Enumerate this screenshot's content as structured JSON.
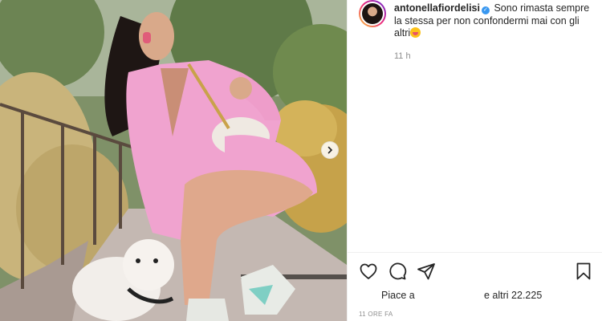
{
  "post": {
    "username": "antonellafiordelisi",
    "caption": "Sono rimasta sempre la stessa per non confondermi mai con gli altri",
    "time_ago": "11 h",
    "likes_prefix": "Piace a",
    "likes_suffix": "e altri 22.225",
    "posted": "11 ORE FA"
  },
  "icons": {
    "verified": "verified-badge-icon",
    "emoji": "grinning-tongue-emoji",
    "like": "heart-icon",
    "comment": "comment-bubble-icon",
    "share": "paper-plane-icon",
    "save": "bookmark-icon",
    "carousel": "chevron-right-icon"
  },
  "colors": {
    "accent": "#3897f0",
    "text": "#262626",
    "muted": "#8e8e8e",
    "divider": "#efefef"
  }
}
